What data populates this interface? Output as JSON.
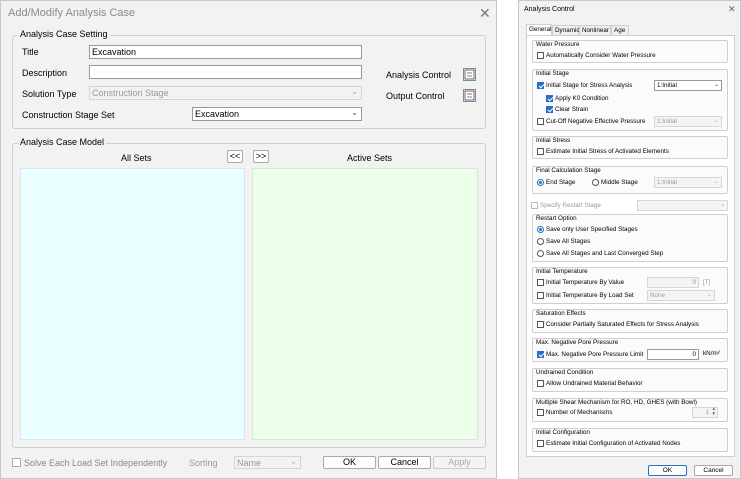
{
  "add_modify": {
    "title": "Add/Modify Analysis Case",
    "close_glyph": "✕",
    "setting": {
      "group_label": "Analysis Case Setting",
      "title_label": "Title",
      "title_value": "Excavation",
      "description_label": "Description",
      "description_value": "",
      "solution_type_label": "Solution Type",
      "solution_type_value": "Construction Stage",
      "stage_set_label": "Construction Stage Set",
      "stage_set_value": "Excavation",
      "analysis_control_label": "Analysis Control",
      "output_control_label": "Output Control"
    },
    "model": {
      "group_label": "Analysis Case Model",
      "all_sets_label": "All Sets",
      "active_sets_label": "Active Sets",
      "move_left_label": "<<",
      "move_right_label": ">>",
      "all_sets_color": "#eaffff",
      "active_sets_color": "#ecffe8"
    },
    "footer": {
      "solve_each_label": "Solve Each Load Set Independently",
      "sorting_label": "Sorting",
      "sorting_value": "Name",
      "ok_label": "OK",
      "cancel_label": "Cancel",
      "apply_label": "Apply"
    }
  },
  "analysis_control": {
    "title": "Analysis Control",
    "close_glyph": "✕",
    "tabs": [
      "General",
      "Dynamic",
      "Nonlinear",
      "Age"
    ],
    "water_pressure": {
      "label": "Water Pressure",
      "auto_label": "Automatically Consider Water Pressure",
      "auto_checked": false
    },
    "initial_stage": {
      "label": "Initial Stage",
      "stress_label": "Initial Stage for Stress Analysis",
      "stress_checked": true,
      "stress_value": "1:Initial",
      "k0_label": "Apply K0 Condition",
      "k0_checked": true,
      "clear_label": "Clear Strain",
      "clear_checked": true,
      "cutoff_label": "Cut-Off Negative Effective Pressure",
      "cutoff_checked": false,
      "cutoff_value": "1:Initial"
    },
    "initial_stress": {
      "label": "Initial Stress",
      "estimate_label": "Estimate Initial Stress of Activated Elements",
      "estimate_checked": false
    },
    "final_stage": {
      "label": "Final Calculation Stage",
      "end_label": "End Stage",
      "middle_label": "Middle Stage",
      "selected": "end",
      "middle_value": "1:Initial"
    },
    "restart_stage": {
      "label": "Specify Restart Stage",
      "checked": false,
      "value": ""
    },
    "restart_option": {
      "label": "Restart Option",
      "options": [
        "Save only User Specified Stages",
        "Save All Stages",
        "Save All Stages and Last Converged Step"
      ],
      "selected_index": 0
    },
    "initial_temperature": {
      "label": "Initial Temperature",
      "by_value_label": "Initial Temperature By Value",
      "by_value_checked": false,
      "value": "0",
      "unit": "[T]",
      "by_load_set_label": "Initial Temperature By Load Set",
      "by_load_set_checked": false,
      "load_set_value": "None"
    },
    "saturation": {
      "label": "Saturation Effects",
      "consider_label": "Consider Partially Saturated Effects for Stress Analysis",
      "consider_checked": false
    },
    "max_negative": {
      "label": "Max. Negative Pore Pressure",
      "limit_label": "Max. Negative Pore Pressure Limit",
      "limit_checked": true,
      "value": "0",
      "unit": "kN/m²"
    },
    "undrained": {
      "label": "Undrained Condition",
      "allow_label": "Allow Undrained Material Behavior",
      "allow_checked": false
    },
    "shear": {
      "label": "Multiple Shear Mechanism for RO, HD, GHES (with Bowl)",
      "number_label": "Number of Mechanisms",
      "number_checked": false,
      "value": "1"
    },
    "initial_configuration": {
      "label": "Initial Configuration",
      "estimate_label": "Estimate Initial Configuration of Activated Nodes",
      "estimate_checked": false
    },
    "ok_label": "OK",
    "cancel_label": "Cancel"
  }
}
